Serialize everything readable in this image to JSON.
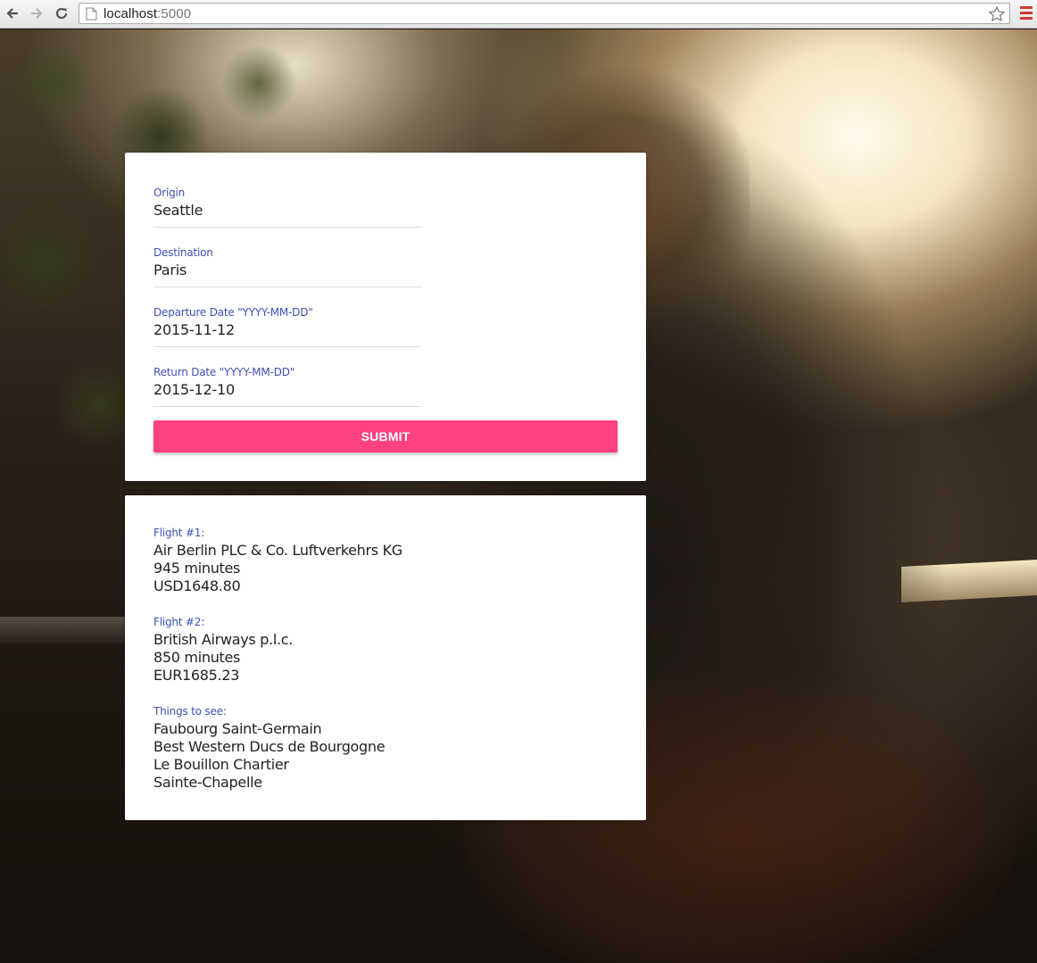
{
  "browser": {
    "url_host": "localhost",
    "url_port": ":5000"
  },
  "form": {
    "origin": {
      "label": "Origin",
      "value": "Seattle"
    },
    "destination": {
      "label": "Destination",
      "value": "Paris"
    },
    "departure": {
      "label": "Departure Date \"YYYY-MM-DD\"",
      "value": "2015-11-12"
    },
    "return": {
      "label": "Return Date \"YYYY-MM-DD\"",
      "value": "2015-12-10"
    },
    "submit_label": "SUBMIT",
    "accent_color": "#3f51b5",
    "button_color": "#ff4081"
  },
  "results": {
    "flight1": {
      "label": "Flight #1:",
      "airline": "Air Berlin PLC & Co. Luftverkehrs KG",
      "duration": "945 minutes",
      "price": "USD1648.80"
    },
    "flight2": {
      "label": "Flight #2:",
      "airline": "British Airways p.l.c.",
      "duration": "850 minutes",
      "price": "EUR1685.23"
    },
    "things": {
      "label": "Things to see:",
      "items": [
        "Faubourg Saint-Germain",
        "Best Western Ducs de Bourgogne",
        "Le Bouillon Chartier",
        "Sainte-Chapelle"
      ]
    }
  }
}
